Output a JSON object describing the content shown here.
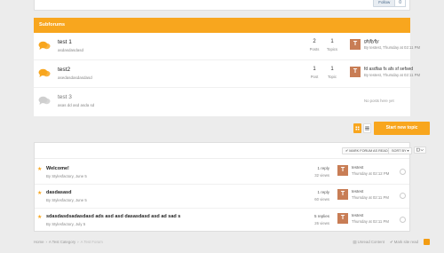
{
  "header": {
    "follow_label": "Follow",
    "follow_count": "0"
  },
  "subforums": {
    "title": "Subforums",
    "posts_label": "Posts",
    "topics_label": "Topics",
    "post_label": "Post",
    "topic_label": "Topic",
    "items": [
      {
        "title": "test 1",
        "desc": "asdasdasdasd",
        "posts": "2",
        "topics": "1",
        "last_title": "ghjfjyfjy",
        "last_meta": "By testest, Thursday at 02:11 PM",
        "avatar": "T"
      },
      {
        "title": "test2",
        "desc": "asedasdasdasdasd",
        "posts": "1",
        "topics": "1",
        "last_title": "fd asdfas fs afs sf sefsed",
        "last_meta": "By testest, Thursday at 02:11 PM",
        "avatar": "T"
      },
      {
        "title": "test 3",
        "desc": "asas dd asd asda sd",
        "no_posts": "No posts here yet"
      }
    ]
  },
  "actions": {
    "start_topic": "Start new topic"
  },
  "toolbar": {
    "mark_read": "✔ MARK FORUM AS READ",
    "sort_by": "SORT BY ▾",
    "filter": "☐ ▾"
  },
  "topics": [
    {
      "title": "Welcome!",
      "meta": "By Stylesfactory, June 5",
      "replies": "1 reply",
      "views": "32 views",
      "avatar": "T",
      "author": "testest",
      "time": "Thursday at 02:12 PM"
    },
    {
      "title": "dasdasasd",
      "meta": "By Stylesfactory, June 5",
      "replies": "1 reply",
      "views": "60 views",
      "avatar": "T",
      "author": "testest",
      "time": "Thursday at 02:11 PM"
    },
    {
      "title": "sdasdasdsadasdasd ads asd asd dasasdasd asd ad sad s",
      "meta": "By Stylesfactory, July 5",
      "replies": "5 replies",
      "views": "26 views",
      "avatar": "T",
      "author": "testest",
      "time": "Thursday at 02:11 PM"
    }
  ],
  "breadcrumb": [
    "Home",
    "A Test Category",
    "A Test Forum"
  ],
  "footer": {
    "unread": "Unread Content",
    "mark_read": "Mark site read"
  },
  "colors": {
    "accent": "#f8a61e",
    "avatar": "#c87d55"
  }
}
